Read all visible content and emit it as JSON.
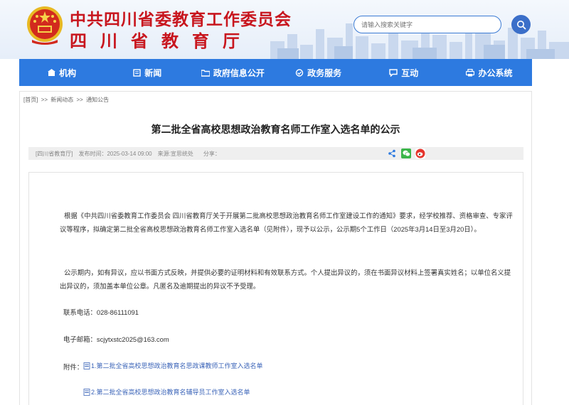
{
  "header": {
    "org_name": "中共四川省委教育工作委员会",
    "dept_name": "四川省教育厅",
    "search_placeholder": "请输入搜索关键字"
  },
  "nav": [
    {
      "label": "机构",
      "icon": "building-icon"
    },
    {
      "label": "新闻",
      "icon": "newspaper-icon"
    },
    {
      "label": "政府信息公开",
      "icon": "folder-icon"
    },
    {
      "label": "政务服务",
      "icon": "handshake-icon"
    },
    {
      "label": "互动",
      "icon": "chat-icon"
    },
    {
      "label": "办公系统",
      "icon": "printer-icon"
    }
  ],
  "breadcrumb": [
    "[首页]",
    ">>",
    "新闻动态",
    ">>",
    "通知公告"
  ],
  "article": {
    "title": "第二批全省高校思想政治教育名师工作室入选名单的公示",
    "source_tag": "[四川省教育厅]",
    "publish_time": "发布时间：2025-03-14 09:00",
    "origin": "来源:宣思统处",
    "share_label": "分享：",
    "para1": "根据《中共四川省委教育工作委员会 四川省教育厅关于开展第二批高校思想政治教育名师工作室建设工作的通知》要求，经学校推荐、资格审查、专家评议等程序，拟确定第二批全省高校思想政治教育名师工作室入选名单（见附件），现予以公示，公示期5个工作日（2025年3月14日至3月20日）。",
    "para2": "公示期内，如有异议，应以书面方式反映，并提供必要的证明材料和有效联系方式。个人提出异议的，须在书面异议材料上签署真实姓名；以单位名义提出异议的，须加盖本单位公章。凡匿名及逾期提出的异议不予受理。",
    "phone": "联系电话：028-86111091",
    "email": "电子邮箱：scjytxstc2025@163.com",
    "attach_label": "附件：",
    "attachments": [
      "1.第二批全省高校思想政治教育名思政课教师工作室入选名单",
      "2.第二批全省高校思想政治教育名辅导员工作室入选名单"
    ]
  },
  "colors": {
    "brand_red": "#c8161e",
    "nav_blue": "#2d7ae0",
    "link_blue": "#3b64b8"
  }
}
